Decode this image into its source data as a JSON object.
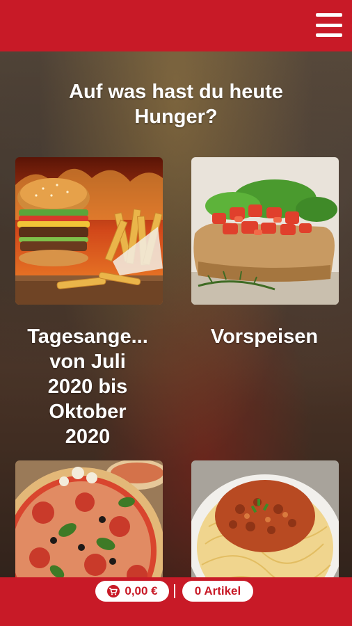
{
  "header": {
    "menu_icon": "hamburger-menu-icon",
    "bar_color": "#c81a27"
  },
  "main": {
    "headline": "Auf was hast du heute Hunger?",
    "categories": [
      {
        "label_lines": [
          "Tagesange...",
          "von Juli",
          "2020 bis",
          "Oktober",
          "2020"
        ],
        "image": "burger-and-fries"
      },
      {
        "label": "Vorspeisen",
        "image": "bruschetta"
      },
      {
        "image": "pizza"
      },
      {
        "image": "spaghetti-bolognese"
      }
    ]
  },
  "footer": {
    "cart_icon": "shopping-cart-icon",
    "cart_total": "0,00 €",
    "item_count": "0 Artikel"
  }
}
